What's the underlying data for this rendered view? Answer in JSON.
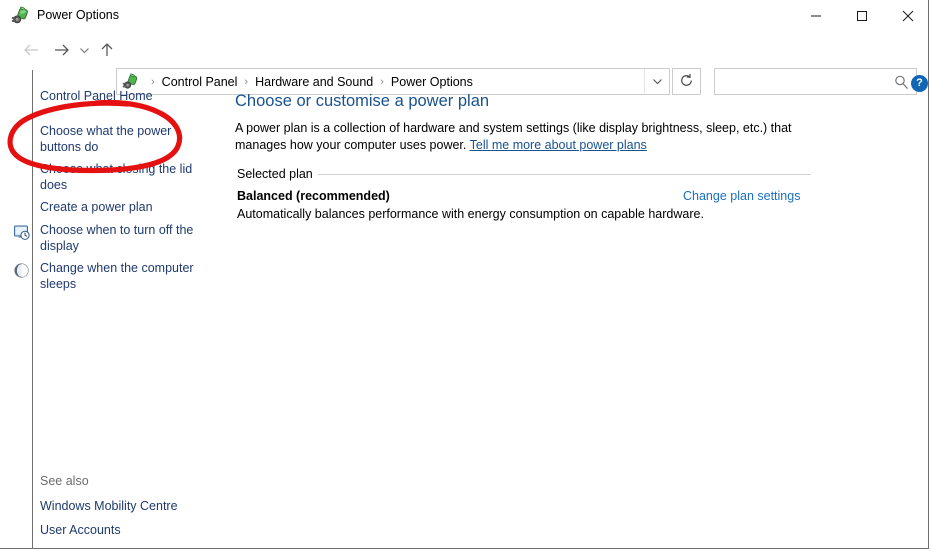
{
  "window": {
    "title": "Power Options",
    "app_icon": "power-plug-battery-icon",
    "controls": {
      "minimize": "minimize-button",
      "maximize": "maximize-button",
      "close": "close-button"
    }
  },
  "toolbar": {
    "back": "back-arrow-icon",
    "forward": "forward-arrow-icon",
    "recent": "recent-locations-chevron-icon",
    "up": "up-arrow-icon",
    "refresh": "refresh-icon",
    "breadcrumb_dropdown": "chevron-down-icon",
    "breadcrumb": [
      "Control Panel",
      "Hardware and Sound",
      "Power Options"
    ],
    "breadcrumb_separator": "›"
  },
  "search": {
    "value": "",
    "placeholder": "",
    "icon": "search-icon"
  },
  "sidebar": {
    "items": [
      {
        "label": "Control Panel Home",
        "icon": null
      },
      {
        "label": "Choose what the power buttons do",
        "icon": null
      },
      {
        "label": "Choose what closing the lid does",
        "icon": null
      },
      {
        "label": "Create a power plan",
        "icon": null
      },
      {
        "label": "Choose when to turn off the display",
        "icon": "display-clock-icon"
      },
      {
        "label": "Change when the computer sleeps",
        "icon": "moon-sleep-icon"
      }
    ],
    "see_also_label": "See also",
    "see_also": [
      {
        "label": "Windows Mobility Centre"
      },
      {
        "label": "User Accounts"
      }
    ]
  },
  "main": {
    "help_label": "?",
    "heading": "Choose or customise a power plan",
    "description_part1": "A power plan is a collection of hardware and system settings (like display brightness, sleep, etc.) that manages how your computer uses power. ",
    "description_link": "Tell me more about power plans",
    "section_label": "Selected plan",
    "plan_name": "Balanced (recommended)",
    "plan_description": "Automatically balances performance with energy consumption on capable hardware.",
    "change_plan_link": "Change plan settings"
  },
  "annotation": {
    "type": "hand-drawn-red-ellipse",
    "color": "#e51111",
    "targets": "Choose what the power buttons do"
  },
  "colors": {
    "heading": "#19528f",
    "link": "#1a6fc4",
    "nav_link": "#1f3a6e",
    "help_badge": "#1166b4",
    "annotation": "#e51111",
    "window_border": "#6f6f6f"
  }
}
